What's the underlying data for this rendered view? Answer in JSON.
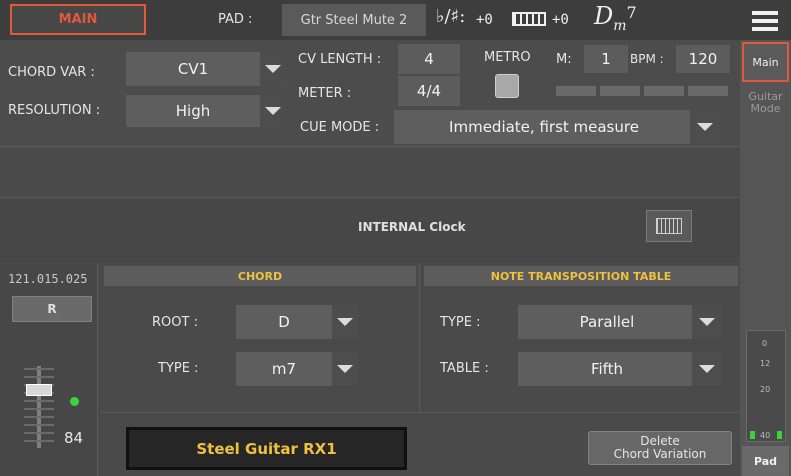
{
  "topbar": {
    "main_label": "MAIN",
    "pad_label": "PAD :",
    "pad_value": "Gtr Steel Mute 2",
    "transpose_symbol": "♭/♯:",
    "transpose_value": "+0",
    "keyboard_value": "+0",
    "chord_root": "D",
    "chord_suffix": "m",
    "chord_ext": "7"
  },
  "settings": {
    "chord_var_label": "CHORD VAR :",
    "chord_var_value": "CV1",
    "resolution_label": "RESOLUTION :",
    "resolution_value": "High",
    "cv_length_label": "CV LENGTH :",
    "cv_length_value": "4",
    "meter_label": "METER :",
    "meter_value": "4/4",
    "metro_label": "METRO",
    "m_label": "M:",
    "m_value": "1",
    "bpm_label": "BPM :",
    "bpm_value": "120",
    "cue_mode_label": "CUE MODE :",
    "cue_mode_value": "Immediate, first measure"
  },
  "clock": {
    "label": "INTERNAL Clock"
  },
  "left_strip": {
    "position": "121.015.025",
    "record_label": "R",
    "volume": "84"
  },
  "chord_panel": {
    "header": "CHORD",
    "root_label": "ROOT :",
    "root_value": "D",
    "type_label": "TYPE :",
    "type_value": "m7"
  },
  "transposition_panel": {
    "header": "NOTE TRANSPOSITION TABLE",
    "type_label": "TYPE :",
    "type_value": "Parallel",
    "table_label": "TABLE :",
    "table_value": "Fifth"
  },
  "bottom": {
    "sound_name": "Steel Guitar RX1",
    "delete_label_1": "Delete",
    "delete_label_2": "Chord Variation"
  },
  "right_tabs": {
    "main_tab": "Main",
    "guitar_mode_1": "Guitar",
    "guitar_mode_2": "Mode",
    "meter_ticks": [
      "0",
      "12",
      "20",
      "40"
    ],
    "pad_tab": "Pad"
  },
  "colors": {
    "accent_red": "#e05a3a",
    "sound_text": "#f0c040",
    "led_green": "#3cd23c"
  }
}
